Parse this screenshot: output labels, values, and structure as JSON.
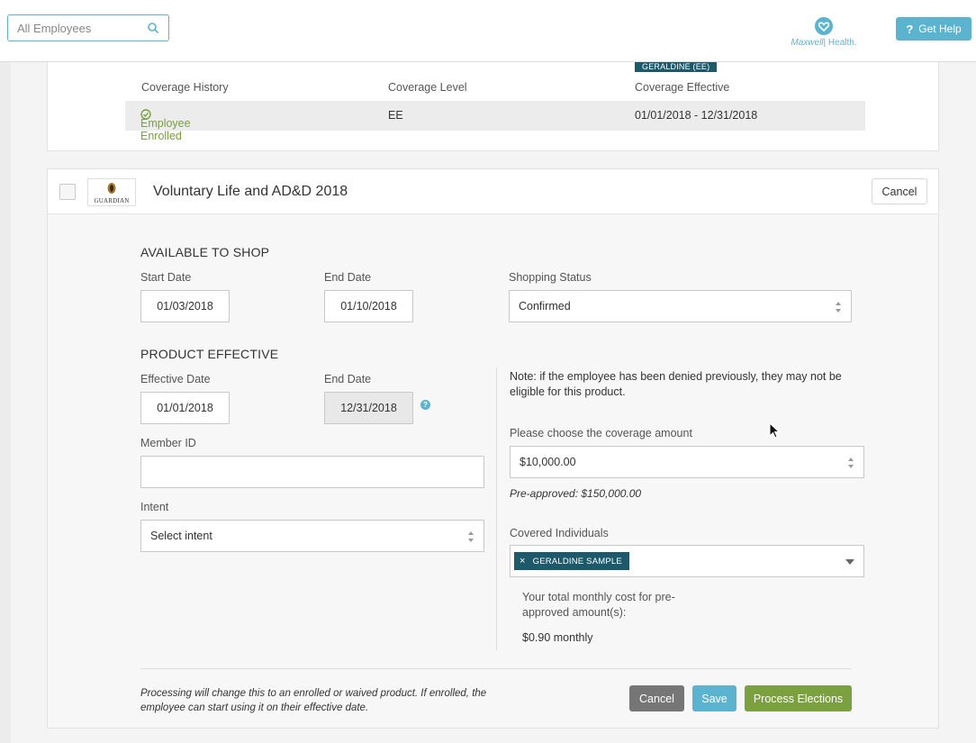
{
  "header": {
    "search_placeholder": "All Employees",
    "logo_text_brand": "Maxwell",
    "logo_text_suffix": "| Health.",
    "help_icon": "?",
    "help_label": "Get Help"
  },
  "coverage_history": {
    "member_tag": "GERALDINE (EE)",
    "headers": [
      "Coverage History",
      "Coverage Level",
      "Coverage Effective"
    ],
    "row": {
      "status": "Employee Enrolled",
      "level": "EE",
      "effective": "01/01/2018 - 12/31/2018"
    }
  },
  "product": {
    "carrier_name": "GUARDIAN",
    "title": "Voluntary Life and AD&D 2018",
    "cancel_label": "Cancel"
  },
  "available_to_shop": {
    "title": "AVAILABLE TO SHOP",
    "start_date_label": "Start Date",
    "start_date": "01/03/2018",
    "end_date_label": "End Date",
    "end_date": "01/10/2018",
    "shopping_status_label": "Shopping Status",
    "shopping_status": "Confirmed"
  },
  "product_effective": {
    "title": "PRODUCT EFFECTIVE",
    "effective_date_label": "Effective Date",
    "effective_date": "01/01/2018",
    "end_date_label": "End Date",
    "end_date": "12/31/2018",
    "member_id_label": "Member ID",
    "member_id": "",
    "intent_label": "Intent",
    "intent": "Select intent"
  },
  "coverage": {
    "note": "Note: if the employee has been denied previously, they may not be eligible for this product.",
    "amount_label": "Please choose the coverage amount",
    "amount": "$10,000.00",
    "preapproved": "Pre-approved: $150,000.00",
    "covered_label": "Covered Individuals",
    "covered_chip": "GERALDINE SAMPLE",
    "chip_remove": "×",
    "total_label": "Your total monthly cost for pre-approved amount(s):",
    "total_value": "$0.90 monthly"
  },
  "footer": {
    "note": "Processing will change this to an enrolled or waived product. If enrolled, the employee can start using it on their effective date.",
    "cancel_label": "Cancel",
    "save_label": "Save",
    "process_label": "Process Elections"
  },
  "colors": {
    "accent": "#5bb4cf",
    "enrolled_green": "#7ba03e",
    "tag_teal": "#1c5a6b",
    "cancel_gray": "#767676"
  }
}
